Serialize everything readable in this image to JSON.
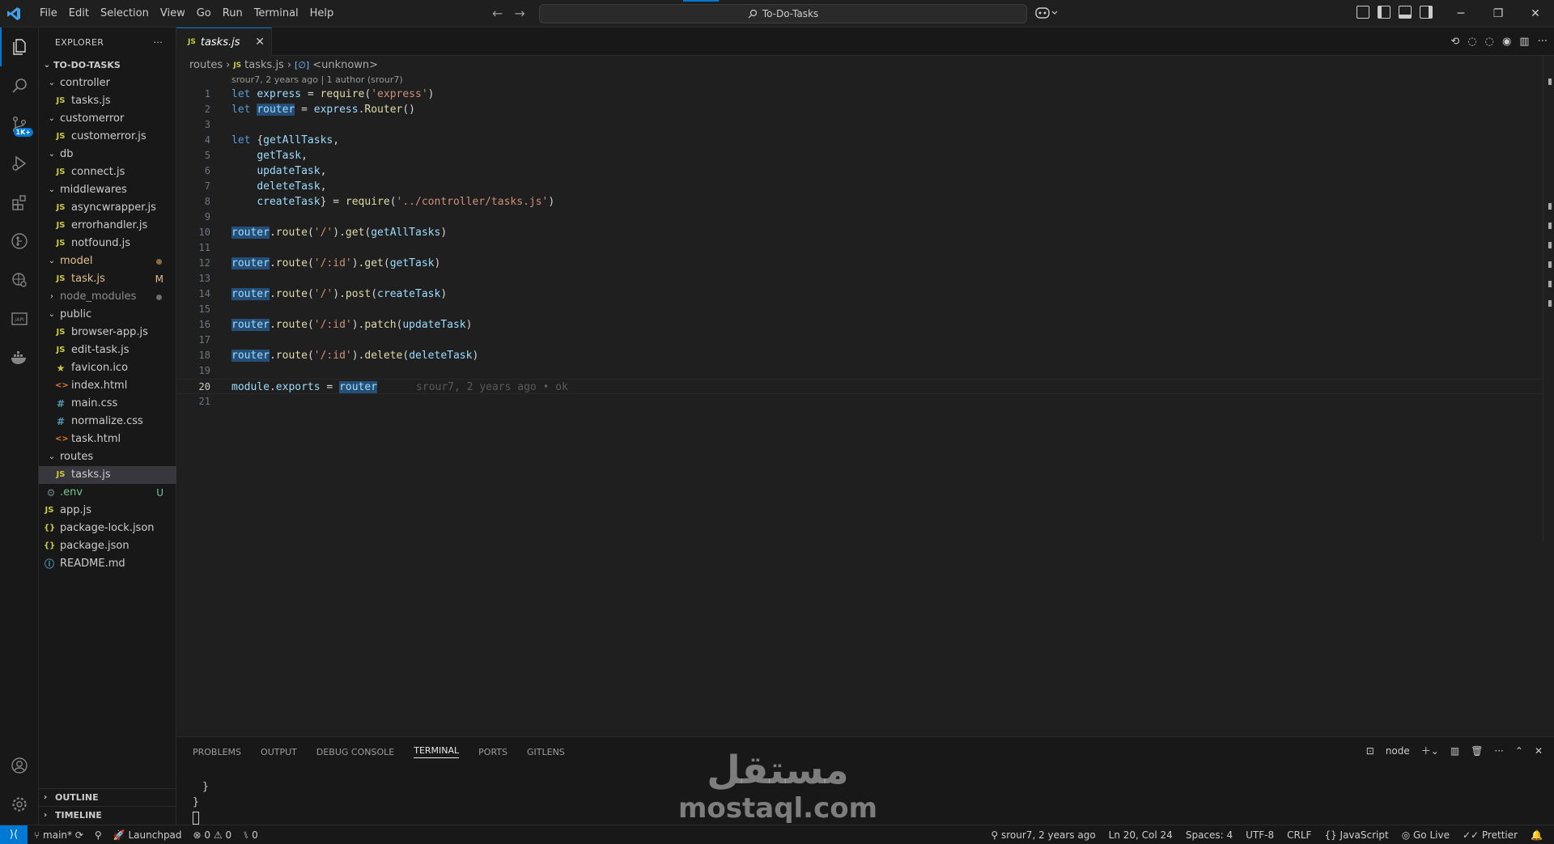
{
  "titlebar": {
    "menu": [
      "File",
      "Edit",
      "Selection",
      "View",
      "Go",
      "Run",
      "Terminal",
      "Help"
    ],
    "command_center": "To-Do-Tasks"
  },
  "activity_bar": {
    "source_control_badge": "1K+"
  },
  "sidebar": {
    "title": "EXPLORER",
    "more_label": "···",
    "root": "TO-DO-TASKS",
    "items": [
      {
        "label": "controller",
        "status": ""
      },
      {
        "label": "tasks.js",
        "status": ""
      },
      {
        "label": "customerror",
        "status": ""
      },
      {
        "label": "customerror.js",
        "status": ""
      },
      {
        "label": "db",
        "status": ""
      },
      {
        "label": "connect.js",
        "status": ""
      },
      {
        "label": "middlewares",
        "status": ""
      },
      {
        "label": "asyncwrapper.js",
        "status": ""
      },
      {
        "label": "errorhandler.js",
        "status": ""
      },
      {
        "label": "notfound.js",
        "status": ""
      },
      {
        "label": "model",
        "status": ""
      },
      {
        "label": "task.js",
        "status": "M"
      },
      {
        "label": "node_modules",
        "status": ""
      },
      {
        "label": "public",
        "status": ""
      },
      {
        "label": "browser-app.js",
        "status": ""
      },
      {
        "label": "edit-task.js",
        "status": ""
      },
      {
        "label": "favicon.ico",
        "status": ""
      },
      {
        "label": "index.html",
        "status": ""
      },
      {
        "label": "main.css",
        "status": ""
      },
      {
        "label": "normalize.css",
        "status": ""
      },
      {
        "label": "task.html",
        "status": ""
      },
      {
        "label": "routes",
        "status": ""
      },
      {
        "label": "tasks.js",
        "status": ""
      },
      {
        "label": ".env",
        "status": "U"
      },
      {
        "label": "app.js",
        "status": ""
      },
      {
        "label": "package-lock.json",
        "status": ""
      },
      {
        "label": "package.json",
        "status": ""
      },
      {
        "label": "README.md",
        "status": ""
      }
    ],
    "outline": "OUTLINE",
    "timeline": "TIMELINE"
  },
  "editor": {
    "tab_label": "tasks.js",
    "tab_badge": "JS",
    "breadcrumb": {
      "folder": "routes",
      "file": "tasks.js",
      "symbol_icon": "[∅]",
      "symbol": "<unknown>"
    },
    "blame_header": "srour7, 2 years ago | 1 author (srour7)",
    "inline_blame": "srour7, 2 years ago • ok",
    "line_numbers": [
      "1",
      "2",
      "3",
      "4",
      "5",
      "6",
      "7",
      "8",
      "9",
      "10",
      "11",
      "12",
      "13",
      "14",
      "15",
      "16",
      "17",
      "18",
      "19",
      "20",
      "21"
    ]
  },
  "panel": {
    "tabs": [
      "PROBLEMS",
      "OUTPUT",
      "DEBUG CONSOLE",
      "TERMINAL",
      "PORTS",
      "GITLENS"
    ],
    "terminal_name": "node",
    "terminal_lines": [
      "}",
      "}"
    ]
  },
  "watermark": {
    "arabic": "مستقل",
    "latin": "mostaql.com"
  },
  "statusbar": {
    "branch": "main*",
    "launchpad": "Launchpad",
    "errors": "0",
    "warnings": "0",
    "ports": "0",
    "blame": "srour7, 2 years ago",
    "position": "Ln 20, Col 24",
    "spaces": "Spaces: 4",
    "encoding": "UTF-8",
    "eol": "CRLF",
    "language": "JavaScript",
    "golive": "Go Live",
    "prettier": "Prettier"
  },
  "colors": {
    "accent": "#0078d4",
    "keyword": "#569cd6",
    "string": "#ce9178",
    "variable": "#9cdcfe",
    "function": "#dcdcaa"
  }
}
